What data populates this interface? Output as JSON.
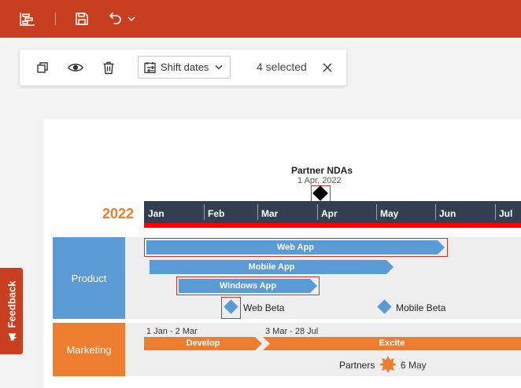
{
  "app_bar": {
    "icons": [
      "gantt-view-icon",
      "save-icon",
      "undo-icon",
      "chevron-down-icon"
    ]
  },
  "toolbar": {
    "shift_label": "Shift dates",
    "selected_text": "4 selected",
    "icons": [
      "copy-icon",
      "eye-icon",
      "trash-icon",
      "calendar-shift-icon",
      "chevron-down-icon",
      "close-icon"
    ]
  },
  "timeline": {
    "year": "2022",
    "months": [
      "Jan",
      "Feb",
      "Mar",
      "Apr",
      "May",
      "Jun",
      "Jul"
    ],
    "milestone": {
      "title": "Partner NDAs",
      "date": "1 Apr, 2022"
    }
  },
  "swimlanes": [
    {
      "label": "Product",
      "color": "#5b9bd5",
      "tasks": [
        "Web App",
        "Mobile App",
        "Windows App"
      ],
      "milestones": [
        "Web Beta",
        "Mobile Beta"
      ]
    },
    {
      "label": "Marketing",
      "color": "#ed7d31",
      "tasks": [
        {
          "name": "Develop",
          "dates": "1 Jan - 2 Mar"
        },
        {
          "name": "Excite",
          "dates": "3 Mar - 28 Jul"
        }
      ],
      "milestone": {
        "name": "Partners",
        "date": "6 May"
      }
    }
  ],
  "feedback_label": "Feedback",
  "colors": {
    "brand": "#c73f1f",
    "timescale": "#333f50",
    "today_line": "#ff0000",
    "year_text": "#ed7d31",
    "product": "#5b9bd5",
    "marketing": "#ed7d31",
    "selection": "#c0392b"
  }
}
